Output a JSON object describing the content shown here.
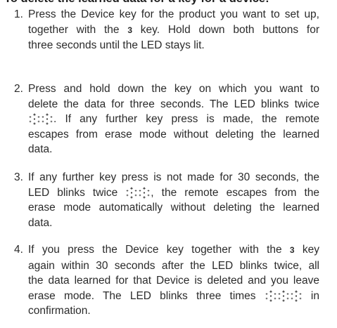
{
  "heading": "To delete the learned data for a key for a device:",
  "steps": [
    {
      "number": "1.",
      "lines": [
        [
          "Press the Device key for the product you want to set up,"
        ],
        [
          "together with the ",
          {
            "key": "3"
          },
          " key. Hold down both buttons for"
        ],
        [
          "three seconds until the LED stays lit."
        ]
      ]
    },
    {
      "number": "2.",
      "lines": [
        [
          "Press and hold down the key on which you want to"
        ],
        [
          "delete the data for three seconds. The LED blinks twice"
        ],
        [
          {
            "led_blinks": 2
          },
          ". If any further key press is made, the remote"
        ],
        [
          "escapes from erase mode without deleting the learned"
        ],
        [
          "data."
        ]
      ]
    },
    {
      "number": "3.",
      "lines": [
        [
          "If any further key press is not made for 30 seconds, the"
        ],
        [
          "LED blinks twice ",
          {
            "led_blinks": 2
          },
          ", the remote escapes from the"
        ],
        [
          "erase mode automatically without deleting the learned"
        ],
        [
          "data."
        ]
      ]
    },
    {
      "number": "4.",
      "lines": [
        [
          "If you press the Device key together with the ",
          {
            "key": "3"
          },
          " key"
        ],
        [
          "again within 30 seconds after the LED blinks twice, all"
        ],
        [
          "the data learned for that Device is deleted and you leave"
        ],
        [
          "erase mode. The LED blinks three times ",
          {
            "led_blinks": 3
          },
          " in"
        ],
        [
          "confirmation."
        ]
      ]
    }
  ],
  "icons": {
    "led_blink": "led-blink-icon"
  }
}
